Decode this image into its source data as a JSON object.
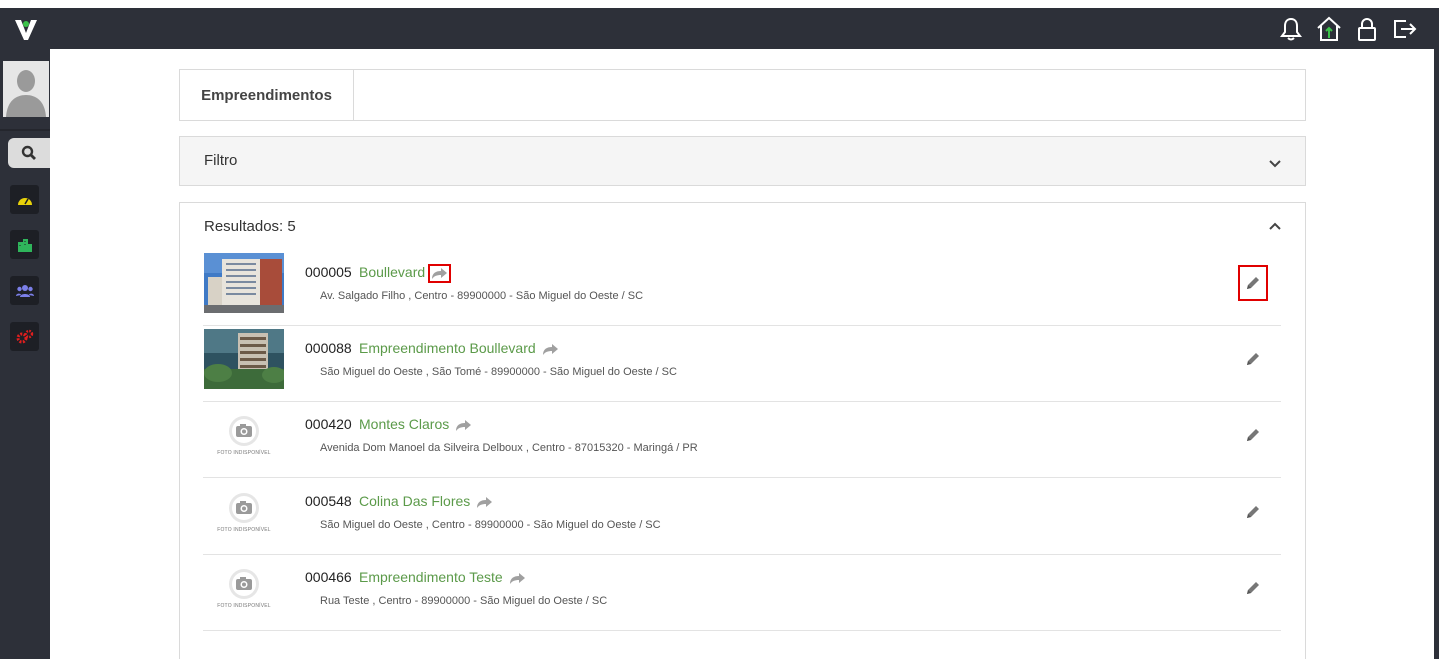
{
  "header": {
    "logo_icon": "v-logo-icon",
    "icons": [
      "bell-icon",
      "home-icon",
      "lock-icon",
      "logout-icon"
    ]
  },
  "sidebar": {
    "items": [
      "search-icon",
      "dashboard-icon",
      "buildings-icon",
      "users-icon",
      "settings-icon"
    ]
  },
  "title_card": {
    "tab": "Empreendimentos"
  },
  "filter": {
    "label": "Filtro"
  },
  "results": {
    "label": "Resultados: 5",
    "items": [
      {
        "code": "000005",
        "name": "Boullevard",
        "address": "Av. Salgado Filho , Centro - 89900000 - São Miguel do Oeste / SC",
        "photo": "building-photo"
      },
      {
        "code": "000088",
        "name": "Empreendimento Boullevard",
        "address": "São Miguel do Oeste , São Tomé - 89900000 - São Miguel do Oeste / SC",
        "photo": "building-photo"
      },
      {
        "code": "000420",
        "name": "Montes Claros",
        "address": "Avenida Dom Manoel da Silveira Delboux , Centro - 87015320 - Maringá / PR",
        "photo": "FOTO INDISPONÍVEL"
      },
      {
        "code": "000548",
        "name": "Colina Das Flores",
        "address": "São Miguel do Oeste , Centro - 89900000 - São Miguel do Oeste / SC",
        "photo": "FOTO INDISPONÍVEL"
      },
      {
        "code": "000466",
        "name": "Empreendimento Teste",
        "address": "Rua Teste , Centro - 89900000 - São Miguel do Oeste / SC",
        "photo": "FOTO INDISPONÍVEL"
      }
    ]
  },
  "colors": {
    "topbar": "#2d3039",
    "link": "#5b9a49",
    "highlight": "#e00000"
  }
}
